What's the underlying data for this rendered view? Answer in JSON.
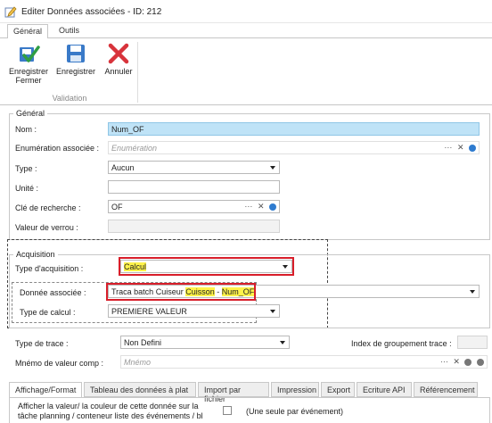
{
  "window": {
    "title": "Editer Données associées - ID: 212"
  },
  "tabs": [
    {
      "label": "Général"
    },
    {
      "label": "Outils"
    }
  ],
  "ribbon": {
    "buttons": [
      {
        "label": "Enregistrer Fermer",
        "icon": "check-save-icon"
      },
      {
        "label": "Enregistrer",
        "icon": "floppy-disk-icon"
      },
      {
        "label": "Annuler",
        "icon": "red-x-icon"
      }
    ],
    "group_label": "Validation"
  },
  "general": {
    "title": "Général",
    "nom_label": "Nom :",
    "nom_value": "Num_OF",
    "enum_label": "Enumération associée :",
    "enum_placeholder": "Enumération",
    "type_label": "Type :",
    "type_value": "Aucun",
    "unite_label": "Unité :",
    "unite_value": "",
    "cle_label": "Clé de recherche :",
    "cle_value": "OF",
    "verrou_label": "Valeur de verrou :",
    "verrou_value": ""
  },
  "acquisition": {
    "title": "Acquisition",
    "type_label": "Type d'acquisition :",
    "type_value": "Calcul",
    "donnee_label": "Donnée associée :",
    "donnee_prefix": "Traca batch Cuiseur ",
    "donnee_highlight1": "Cuisson",
    "donnee_sep": " - ",
    "donnee_highlight2": "Num_OF",
    "calcul_label": "Type de calcul :",
    "calcul_value": "PREMIERE VALEUR"
  },
  "extra": {
    "trace_label": "Type de trace :",
    "trace_value": "Non Defini",
    "index_label": "Index de groupement trace :",
    "mnemo_label": "Mnémo de valeur comp :",
    "mnemo_placeholder": "Mnémo"
  },
  "bottom_tabs": [
    {
      "label": "Affichage/Format"
    },
    {
      "label": "Tableau des données à plat"
    },
    {
      "label": "Import par fichier"
    },
    {
      "label": "Impression"
    },
    {
      "label": "Export"
    },
    {
      "label": "Ecriture API"
    },
    {
      "label": "Référencement"
    }
  ],
  "affichage": {
    "text_line1": "Afficher la valeur/ la couleur de cette donnée sur la",
    "text_line2": "tâche planning / conteneur liste des événements / bl",
    "checkbox_label": "(Une seule par événement)",
    "checked": false
  },
  "colors": {
    "accent_blue": "#2e7bcf",
    "highlight": "#fff34a",
    "red_box": "#d81e2a",
    "selected_bg": "#bfe3f7"
  }
}
